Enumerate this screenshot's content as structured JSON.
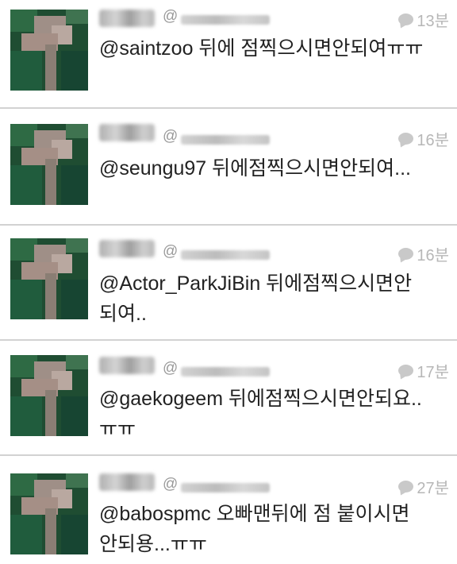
{
  "tweets": [
    {
      "name": "",
      "handle": "@",
      "time": "13분",
      "text": "@saintzoo 뒤에 점찍으시면안되여ㅠㅠ"
    },
    {
      "name": "",
      "handle": "@",
      "time": "16분",
      "text": "@seungu97 뒤에점찍으시면안되여..."
    },
    {
      "name": "",
      "handle": "@",
      "time": "16분",
      "text": "@Actor_ParkJiBin 뒤에점찍으시면안\n되여.."
    },
    {
      "name": "",
      "handle": "@",
      "time": "17분",
      "text": "@gaekogeem 뒤에점찍으시면안되요..\nㅠㅠ"
    },
    {
      "name": "",
      "handle": "@",
      "time": "27분",
      "text": "@babospmc 오빠맨뒤에 점 붙이시면\n안되용...ㅠㅠ"
    }
  ],
  "icons": {
    "timestamp": "speech-bubble-icon"
  },
  "colors": {
    "divider": "#d2d2d2",
    "text": "#222222",
    "meta": "#b7b7b7"
  }
}
